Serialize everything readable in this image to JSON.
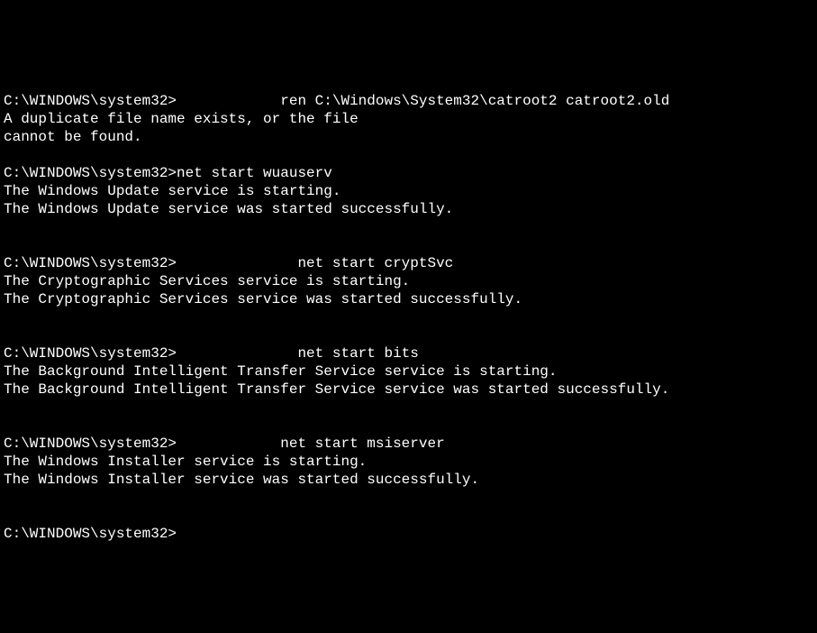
{
  "blocks": [
    {
      "prompt": "C:\\WINDOWS\\system32>",
      "prompt_pad": "            ",
      "command": "ren C:\\Windows\\System32\\catroot2 catroot2.old",
      "output": [
        "A duplicate file name exists, or the file",
        "cannot be found."
      ]
    },
    {
      "prompt": "C:\\WINDOWS\\system32>",
      "prompt_pad": "",
      "command": "net start wuauserv",
      "output": [
        "The Windows Update service is starting.",
        "The Windows Update service was started successfully."
      ]
    },
    {
      "prompt": "C:\\WINDOWS\\system32>",
      "prompt_pad": "              ",
      "command": "net start cryptSvc",
      "output": [
        "The Cryptographic Services service is starting.",
        "The Cryptographic Services service was started successfully."
      ]
    },
    {
      "prompt": "C:\\WINDOWS\\system32>",
      "prompt_pad": "              ",
      "command": "net start bits",
      "output": [
        "The Background Intelligent Transfer Service service is starting.",
        "The Background Intelligent Transfer Service service was started successfully."
      ]
    },
    {
      "prompt": "C:\\WINDOWS\\system32>",
      "prompt_pad": "            ",
      "command": "net start msiserver",
      "output": [
        "The Windows Installer service is starting.",
        "The Windows Installer service was started successfully."
      ]
    }
  ],
  "final_prompt": "C:\\WINDOWS\\system32>"
}
